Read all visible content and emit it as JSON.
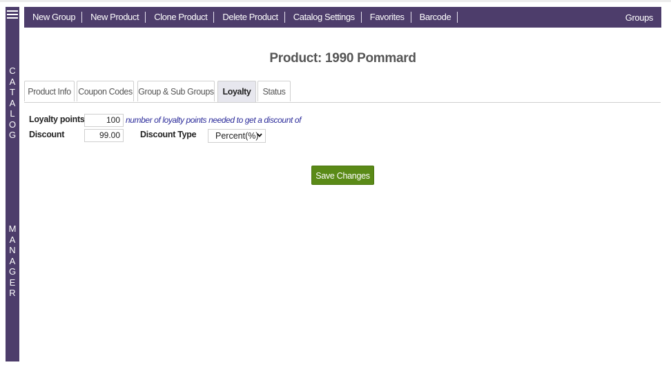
{
  "sidebar": {
    "menu_icon": "hamburger-icon",
    "word1": [
      "C",
      "A",
      "T",
      "A",
      "L",
      "O",
      "G"
    ],
    "word2": [
      "M",
      "A",
      "N",
      "A",
      "G",
      "E",
      "R"
    ]
  },
  "toolbar": {
    "items": [
      "New Group",
      "New Product",
      "Clone Product",
      "Delete Product",
      "Catalog Settings",
      "Favorites",
      "Barcode"
    ],
    "right": "Groups"
  },
  "page": {
    "title": "Product: 1990 Pommard"
  },
  "tabs": [
    "Product Info",
    "Coupon Codes",
    "Group & Sub Groups",
    "Loyalty",
    "Status"
  ],
  "active_tab": "Loyalty",
  "form": {
    "loyalty_points_label": "Loyalty points",
    "loyalty_points_value": "100",
    "hint": "number of loyalty points needed to get a discount of",
    "discount_label": "Discount",
    "discount_value": "99.00",
    "discount_type_label": "Discount Type",
    "discount_type_value": "Percent(%)"
  },
  "save_label": "Save Changes",
  "colors": {
    "bar": "#4d3d6b",
    "save": "#5a8a17",
    "hint": "#2b2b9a"
  }
}
